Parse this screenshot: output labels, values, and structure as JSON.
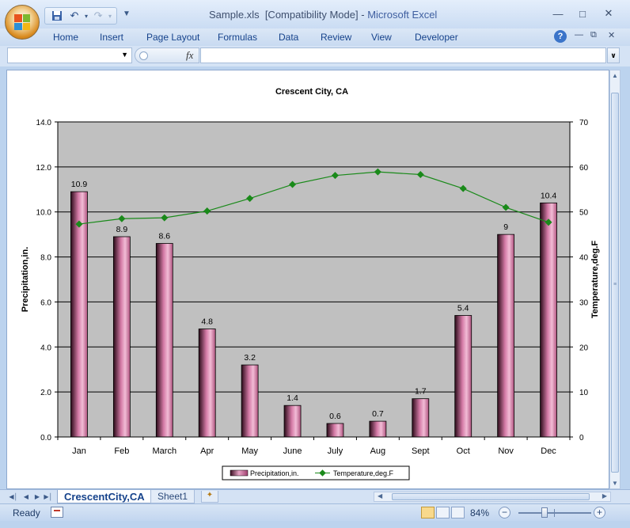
{
  "window": {
    "filename": "Sample.xls",
    "mode": "[Compatibility Mode]",
    "separator": "-",
    "app": "Microsoft Excel"
  },
  "ribbon": {
    "tabs": [
      "Home",
      "Insert",
      "Page Layout",
      "Formulas",
      "Data",
      "Review",
      "View",
      "Developer"
    ],
    "help_label": "?"
  },
  "formula_bar": {
    "name_box_value": "",
    "fx_label": "fx",
    "formula_value": ""
  },
  "chart_data": {
    "type": "bar",
    "title": "Crescent City, CA",
    "categories": [
      "Jan",
      "Feb",
      "March",
      "Apr",
      "May",
      "June",
      "July",
      "Aug",
      "Sept",
      "Oct",
      "Nov",
      "Dec"
    ],
    "series": [
      {
        "name": "Precipitation,in.",
        "type": "bar",
        "axis": "left",
        "values": [
          10.9,
          8.9,
          8.6,
          4.8,
          3.2,
          1.4,
          0.6,
          0.7,
          1.7,
          5.4,
          9,
          10.4
        ],
        "labels": [
          "10.9",
          "8.9",
          "8.6",
          "4.8",
          "3.2",
          "1.4",
          "0.6",
          "0.7",
          "1.7",
          "5.4",
          "9",
          "10.4"
        ],
        "color": "#d47aa6"
      },
      {
        "name": "Temperature,deg.F",
        "type": "line",
        "axis": "right",
        "values": [
          47.3,
          48.5,
          48.7,
          50.2,
          53.0,
          56.1,
          58.1,
          58.9,
          58.3,
          55.2,
          51.0,
          47.7
        ],
        "color": "#1a8a1a"
      }
    ],
    "ylabel": "Precipitation,in.",
    "ylabel_right": "Temperature,deg.F",
    "ylim": [
      0,
      14
    ],
    "ylim_right": [
      0,
      70
    ],
    "yticks": [
      "0.0",
      "2.0",
      "4.0",
      "6.0",
      "8.0",
      "10.0",
      "12.0",
      "14.0"
    ],
    "yticks_right": [
      "0",
      "10",
      "20",
      "30",
      "40",
      "50",
      "60",
      "70"
    ],
    "plot_background": "#c0c0c0",
    "grid": true,
    "legend": "bottom"
  },
  "sheet_tabs": [
    "CrescentCity,CA",
    "Sheet1"
  ],
  "status": {
    "text": "Ready",
    "zoom": "84%"
  }
}
